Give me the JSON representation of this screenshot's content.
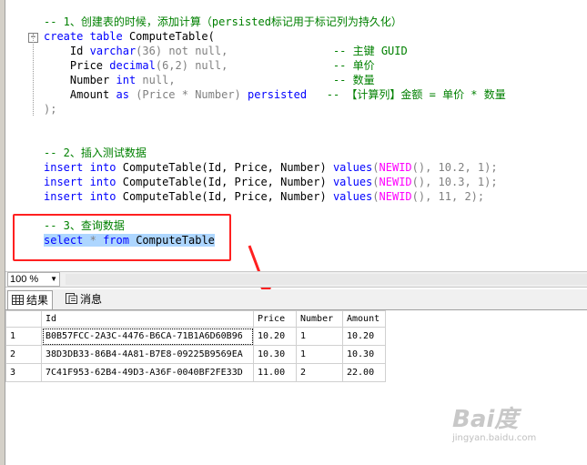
{
  "code": {
    "comment1": "-- 1、创建表的时候，添加计算（persisted标记用于标记列为持久化）",
    "create_kw": "create table",
    "create_name": "ComputeTable(",
    "col_id_name": "Id",
    "col_id_type": "varchar",
    "col_id_size": "(36)",
    "col_id_null": "not null,",
    "col_id_comment": "-- 主键 GUID",
    "col_price_name": "Price",
    "col_price_type": "decimal",
    "col_price_size": "(6,2)",
    "col_price_null": "null,",
    "col_price_comment": "-- 单价",
    "col_num_name": "Number",
    "col_num_type": "int",
    "col_num_null": "null,",
    "col_num_comment": "-- 数量",
    "col_amt_name": "Amount",
    "col_amt_as": "as",
    "col_amt_expr": "(Price * Number)",
    "col_amt_persisted": "persisted",
    "col_amt_comment": "-- 【计算列】金额 = 单价 * 数量",
    "close": ");",
    "comment2": "-- 2、插入测试数据",
    "inserts": [
      {
        "kw1": "insert",
        "kw2": "into",
        "table": "ComputeTable(Id, Price, Number)",
        "kw3": "values",
        "fn": "NEWID",
        "args": "(), 10.2, 1);"
      },
      {
        "kw1": "insert",
        "kw2": "into",
        "table": "ComputeTable(Id, Price, Number)",
        "kw3": "values",
        "fn": "NEWID",
        "args": "(), 10.3, 1);"
      },
      {
        "kw1": "insert",
        "kw2": "into",
        "table": "ComputeTable(Id, Price, Number)",
        "kw3": "values",
        "fn": "NEWID",
        "args": "(), 11, 2);"
      }
    ],
    "comment3": "-- 3、查询数据",
    "select_kw": "select",
    "select_star": "*",
    "select_from": "from",
    "select_table": "ComputeTable"
  },
  "zoom": {
    "value": "100 %"
  },
  "tabs": [
    {
      "label": "结果",
      "icon": "grid-icon"
    },
    {
      "label": "消息",
      "icon": "message-icon"
    }
  ],
  "results": {
    "columns": [
      "Id",
      "Price",
      "Number",
      "Amount"
    ],
    "rows": [
      {
        "n": "1",
        "id": "B0B57FCC-2A3C-4476-B6CA-71B1A6D60B96",
        "price": "10.20",
        "number": "1",
        "amount": "10.20"
      },
      {
        "n": "2",
        "id": "38D3DB33-86B4-4A81-B7E8-09225B9569EA",
        "price": "10.30",
        "number": "1",
        "amount": "10.30"
      },
      {
        "n": "3",
        "id": "7C41F953-62B4-49D3-A36F-0040BF2FE33D",
        "price": "11.00",
        "number": "2",
        "amount": "22.00"
      }
    ]
  },
  "watermark": {
    "main": "Bai度",
    "sub": "jingyan.baidu.com"
  },
  "colors": {
    "keyword": "#0000ff",
    "comment": "#008000",
    "function": "#ff00ff",
    "selection": "#add6ff",
    "highlight_box": "#ff2020"
  }
}
